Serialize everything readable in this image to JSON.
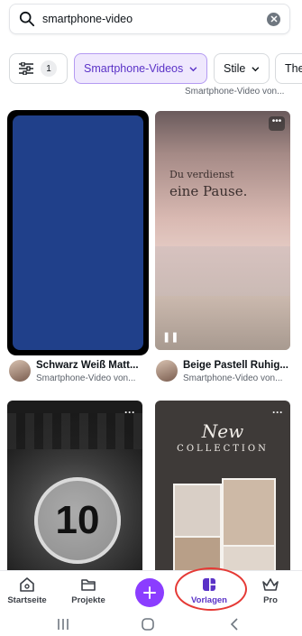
{
  "search": {
    "value": "smartphone-video"
  },
  "filters": {
    "count": "1",
    "active_chip": "Smartphone-Videos",
    "style_chip": "Stile",
    "theme_chip": "The"
  },
  "grid": {
    "clipped_label": "Smartphone-Video von...",
    "cards": [
      {
        "title": "Schwarz Weiß Matt...",
        "subtitle": "Smartphone-Video von..."
      },
      {
        "title": "Beige Pastell Ruhig...",
        "subtitle": "Smartphone-Video von...",
        "text_line1": "Du verdienst",
        "text_line2": "eine Pause."
      },
      {
        "number": "10"
      },
      {
        "text_line1": "New",
        "text_line2": "COLLECTION"
      }
    ]
  },
  "bottom_nav": {
    "items": [
      {
        "label": "Startseite"
      },
      {
        "label": "Projekte"
      },
      {
        "label": "Vorlagen"
      },
      {
        "label": "Pro"
      }
    ]
  },
  "colors": {
    "accent": "#8b3dff",
    "active_text": "#5a32c7",
    "annotation": "#e53935"
  }
}
